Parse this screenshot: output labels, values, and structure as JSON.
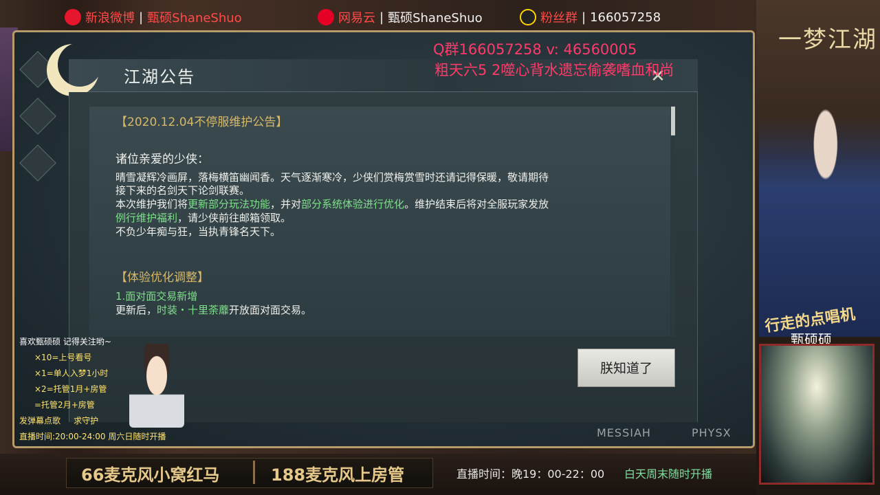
{
  "topbar": {
    "weibo": {
      "icon": "weibo-icon",
      "label": "新浪微博",
      "name": "甄硕ShaneShuo"
    },
    "netease": {
      "icon": "netease-music-icon",
      "label": "网易云",
      "name": "甄硕ShaneShuo"
    },
    "qq": {
      "icon": "qq-penguin-icon",
      "label": "粉丝群",
      "number": "166057258"
    }
  },
  "overlay": {
    "line1": "Q群166057258 v: 46560005",
    "line2": "粗天六5 2噬心背水遗忘偷袭嗜血和尚"
  },
  "game_logo": "一梦江湖",
  "notice": {
    "title": "江湖公告",
    "close_icon": "close-icon",
    "heading": "【2020.12.04不停服维护公告】",
    "greeting": "诸位亲爱的少侠：",
    "p1a": "晴雪凝辉冷画屏，落梅横笛幽闻香。天气逐渐寒冷，少侠们赏梅赏雪时还请记得保暖，敬请期待",
    "p1b": "接下来的名剑天下论剑联赛。",
    "p2_pre": "本次维护我们将",
    "p2_hl1": "更新部分玩法功能",
    "p2_mid": "，并对",
    "p2_hl2": "部分系统体验进行优化",
    "p2_post": "。维护结束后将对全服玩家发放",
    "p3_hl": "例行维护福利",
    "p3_post": "，请少侠前往邮箱领取。",
    "p4": "不负少年痴与狂，当执青锋名天下。",
    "section": "【体验优化调整】",
    "item1": "1.面对面交易新增",
    "item1_pre": "更新后，",
    "item1_hl": "时装・十里荼蘼",
    "item1_post": "开放面对面交易。",
    "ack_button": "朕知道了"
  },
  "game_brands": {
    "messiah": "MESSIAH",
    "physx": "PHYSX"
  },
  "streamer": {
    "slogan": "行走的点唱机",
    "name": "甄硕硕"
  },
  "rules": {
    "title": "喜欢甄硕硕 记得关注哟~",
    "r1": "×10=上号看号",
    "r2": "×1=单人入梦1小时",
    "r3": "×2=托管1月+房管",
    "r4": "=托管2月+房管",
    "r5a": "发弹幕点歌",
    "r5b": "求守护",
    "r6": "直播时间:20:00-24:00 周六日随时开播"
  },
  "bottom": {
    "item1": "66麦克风小窝红马",
    "item2": "188麦克风上房管",
    "live_time": "直播时间：晚19：00-22：00",
    "live_extra": "白天周末随时开播"
  }
}
